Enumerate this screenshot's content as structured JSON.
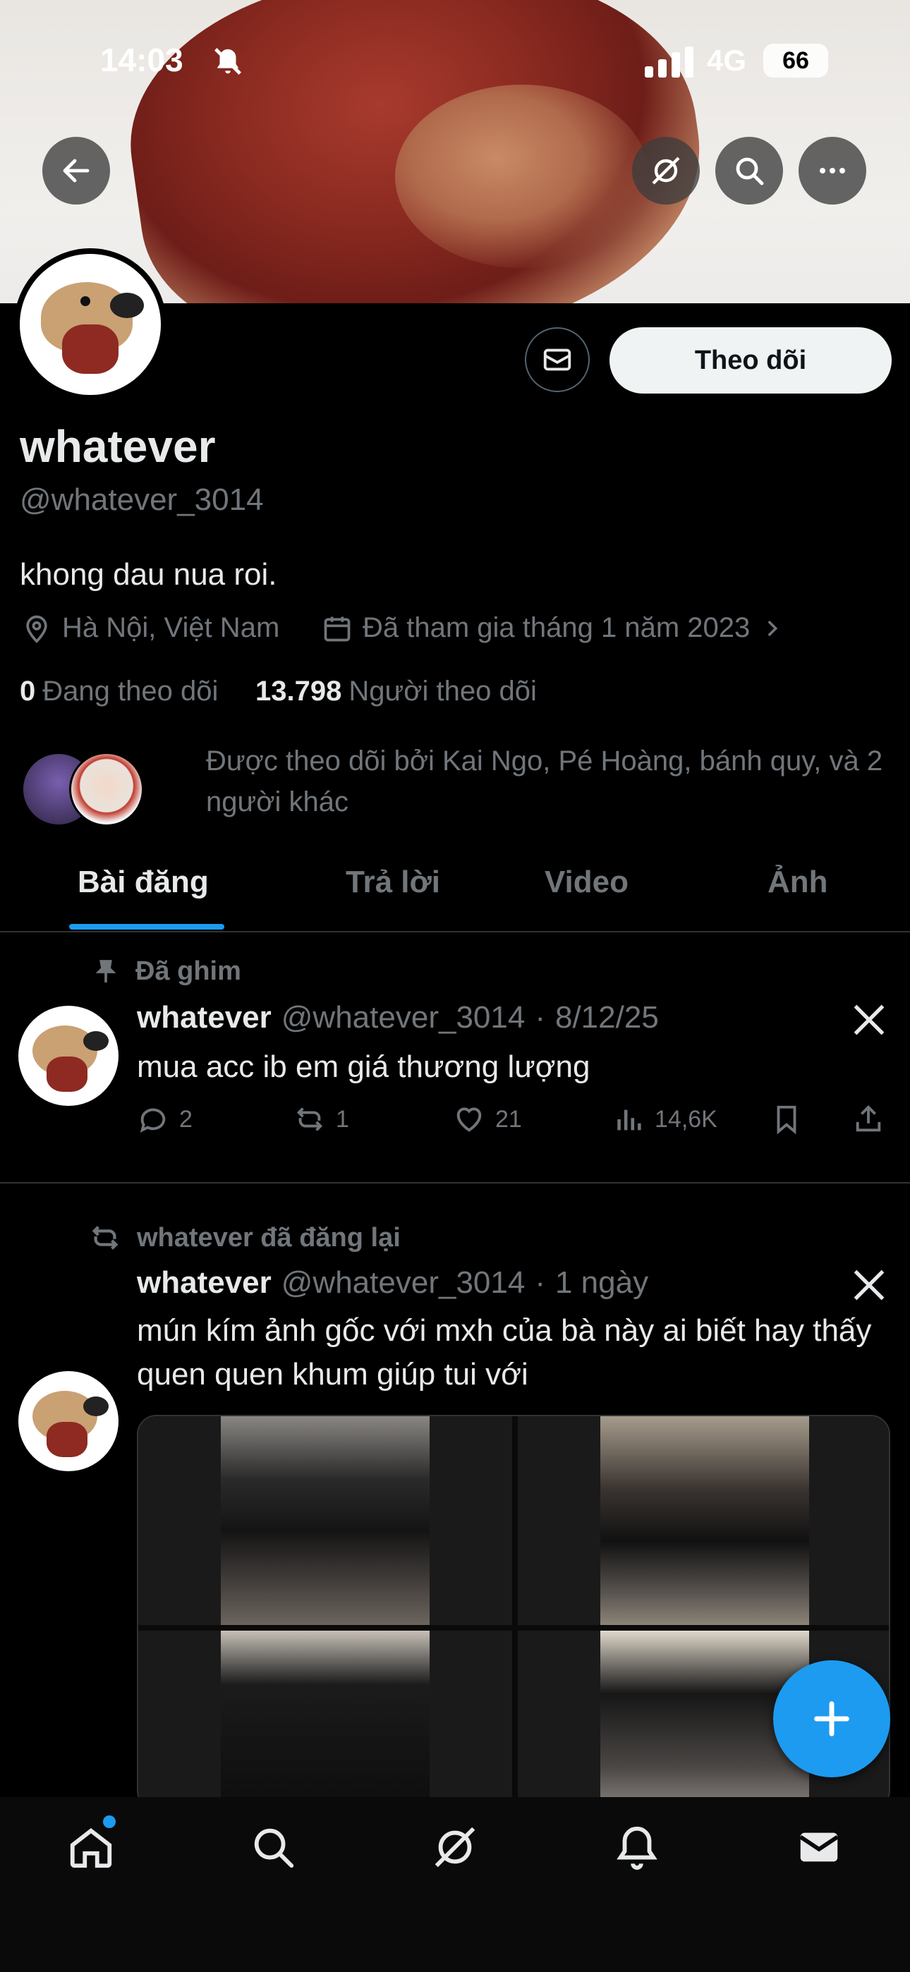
{
  "status_bar": {
    "time": "14:03",
    "network": "4G",
    "battery": "66"
  },
  "profile": {
    "display_name": "whatever",
    "handle": "@whatever_3014",
    "bio": "khong dau nua roi.",
    "location": "Hà Nội, Việt Nam",
    "joined": "Đã tham gia tháng 1 năm 2023",
    "following_count": "0",
    "following_label": "Đang theo dõi",
    "followers_count": "13.798",
    "followers_label": "Người theo dõi",
    "followed_by": "Được theo dõi bởi Kai Ngo, Pé Hoàng, bánh quy, và 2 người khác",
    "follow_button": "Theo dõi"
  },
  "tabs": [
    "Bài đăng",
    "Trả lời",
    "Video",
    "Ảnh"
  ],
  "posts": [
    {
      "context": "Đã ghim",
      "name": "whatever",
      "handle": "@whatever_3014",
      "dot": "·",
      "time": "8/12/25",
      "text": "mua acc ib em giá thương lượng",
      "replies": "2",
      "reposts": "1",
      "likes": "21",
      "views": "14,6K"
    },
    {
      "context": "whatever đã đăng lại",
      "name": "whatever",
      "handle": "@whatever_3014",
      "dot": "·",
      "time": "1 ngày",
      "text": "mún kím ảnh gốc với mxh của bà này ai biết hay thấy quen quen khum giúp tui với"
    }
  ],
  "colors": {
    "accent": "#1d9bf0",
    "background": "#000000",
    "muted": "#71767b"
  },
  "icons": [
    "back-arrow-icon",
    "grok-icon",
    "search-icon",
    "more-icon",
    "mail-icon",
    "location-icon",
    "calendar-icon",
    "pin-icon",
    "x-logo-icon",
    "reply-icon",
    "repost-icon",
    "like-icon",
    "views-icon",
    "bookmark-icon",
    "share-icon",
    "plus-icon",
    "home-icon",
    "bell-icon"
  ]
}
